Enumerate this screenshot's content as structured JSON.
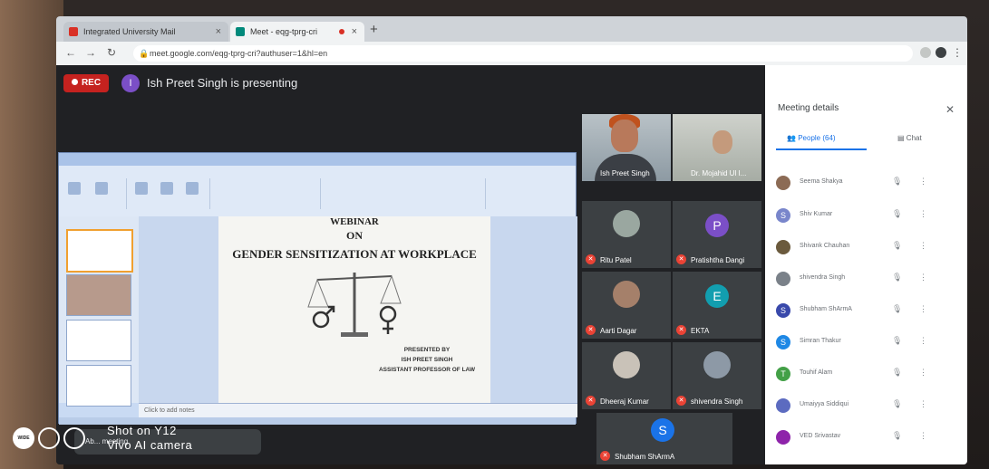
{
  "browser": {
    "tabs": [
      {
        "label": "Integrated University Mail"
      },
      {
        "label": "Meet - eqg-tprg-cri"
      }
    ],
    "url": "meet.google.com/eqg-tprg-cri?authuser=1&hl=en"
  },
  "meet": {
    "rec_label": "REC",
    "presenter_initial": "I",
    "presenting_text": "Ish Preet Singh is presenting",
    "bottom_text": "Ab... meeting"
  },
  "slide": {
    "line1": "WEBINAR",
    "line2": "ON",
    "title": "GENDER SENSITIZATION AT WORKPLACE",
    "presented_by": "PRESENTED BY",
    "presenter": "ISH PREET SINGH",
    "role": "ASSISTANT PROFESSOR OF LAW",
    "notes_placeholder": "Click to add notes"
  },
  "tiles": [
    {
      "name": "Ish Preet Singh",
      "kind": "video"
    },
    {
      "name": "Dr. Mojahid Ul I...",
      "kind": "video"
    },
    {
      "name": "Ritu Patel",
      "kind": "photo"
    },
    {
      "name": "Pratishtha Dangi",
      "kind": "letter",
      "initial": "P",
      "color": "#7b4fc7"
    },
    {
      "name": "Aarti Dagar",
      "kind": "photo"
    },
    {
      "name": "EKTA",
      "kind": "letter",
      "initial": "E",
      "color": "#129eaf"
    },
    {
      "name": "Dheeraj Kumar",
      "kind": "photo"
    },
    {
      "name": "shivendra Singh",
      "kind": "photo"
    },
    {
      "name": "Shubham ShArmA",
      "kind": "letter",
      "initial": "S",
      "color": "#1a73e8"
    }
  ],
  "panel": {
    "title": "Meeting details",
    "people_tab": "People (64)",
    "chat_tab": "Chat",
    "participants": [
      {
        "name": "Seema Shakya",
        "initial": "",
        "color": "#8c6b55"
      },
      {
        "name": "Shiv Kumar",
        "initial": "S",
        "color": "#7986cb"
      },
      {
        "name": "Shivank Chauhan",
        "initial": "",
        "color": "#6b5a3d"
      },
      {
        "name": "shivendra Singh",
        "initial": "",
        "color": "#7a8189"
      },
      {
        "name": "Shubham ShArmA",
        "initial": "S",
        "color": "#3949ab"
      },
      {
        "name": "Simran Thakur",
        "initial": "S",
        "color": "#1e88e5"
      },
      {
        "name": "Touhif Alam",
        "initial": "T",
        "color": "#43a047"
      },
      {
        "name": "Umaiyya Siddiqui",
        "initial": "",
        "color": "#5c6bc0"
      },
      {
        "name": "VED Srivastav",
        "initial": "",
        "color": "#8e24aa"
      }
    ]
  },
  "watermark": {
    "badge": "WIDE",
    "line1": "Shot on Y12",
    "line2": "Vivo AI camera"
  }
}
